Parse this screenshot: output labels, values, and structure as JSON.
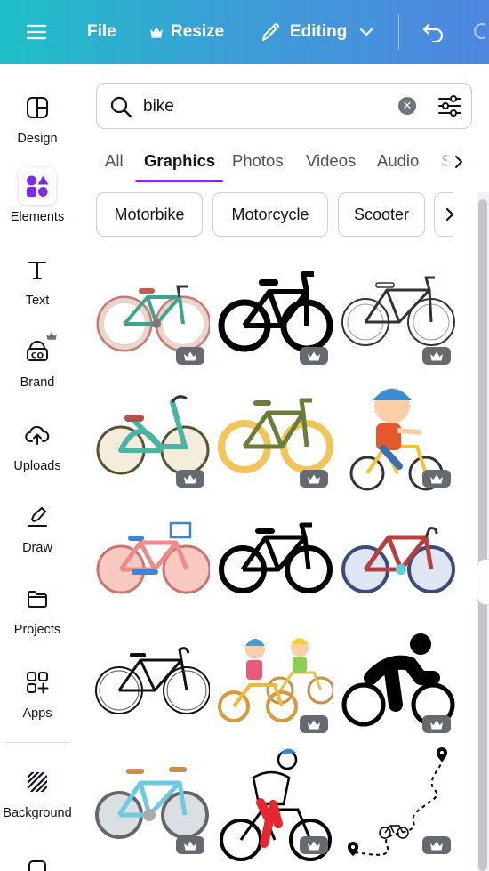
{
  "topbar": {
    "menu_icon": "hamburger-menu-icon",
    "file_label": "File",
    "resize_label": "Resize",
    "editing_label": "Editing",
    "undo_icon": "undo-icon"
  },
  "sidebar": {
    "items": [
      {
        "label": "Design",
        "icon": "layout-icon"
      },
      {
        "label": "Elements",
        "icon": "shapes-icon"
      },
      {
        "label": "Text",
        "icon": "text-icon"
      },
      {
        "label": "Brand",
        "icon": "brand-icon"
      },
      {
        "label": "Uploads",
        "icon": "cloud-upload-icon"
      },
      {
        "label": "Draw",
        "icon": "pen-icon"
      },
      {
        "label": "Projects",
        "icon": "folder-icon"
      },
      {
        "label": "Apps",
        "icon": "apps-icon"
      },
      {
        "label": "Background",
        "icon": "background-icon"
      }
    ]
  },
  "search": {
    "value": "bike",
    "clear_icon": "clear-icon",
    "filter_icon": "filter-sliders-icon"
  },
  "tabs": [
    "All",
    "Graphics",
    "Photos",
    "Videos",
    "Audio",
    "S"
  ],
  "active_tab": "Graphics",
  "chips": [
    "Motorbike",
    "Motorcycle",
    "Scooter"
  ],
  "grid": {
    "premium_badge_icon": "crown-icon",
    "items": [
      "green-vintage-bicycle",
      "black-bicycle-silhouette",
      "outline-road-bike",
      "teal-cruiser-bicycle",
      "yellow-olive-bicycle",
      "boy-riding-bicycle",
      "pink-bicycle-with-basket",
      "black-bicycle-silhouette-2",
      "blue-red-road-bike",
      "line-drawing-road-bike",
      "kids-riding-bicycles",
      "cyclist-pictogram",
      "light-blue-bicycle",
      "man-riding-bicycle",
      "dotted-route-map-bicycle"
    ]
  },
  "colors": {
    "accent": "#7d2ae8",
    "topbar_start": "#1fbfc8",
    "topbar_end": "#4f86e0",
    "badge": "#646a70"
  }
}
